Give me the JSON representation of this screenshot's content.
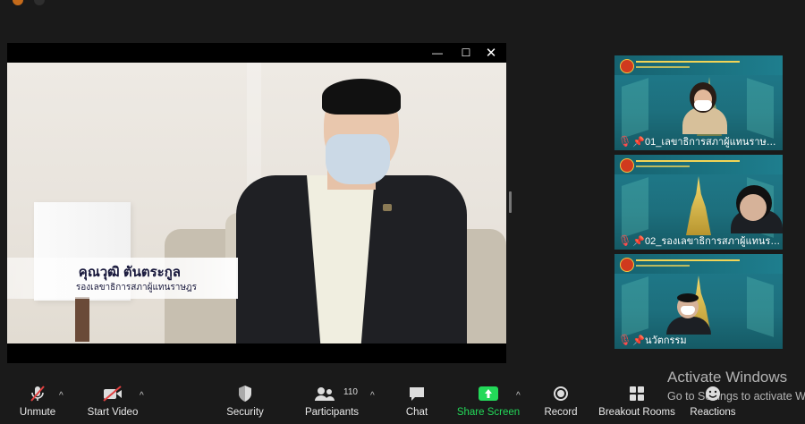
{
  "window_controls": {
    "minimize": "—",
    "maximize": "☐",
    "close": "✕"
  },
  "shared_video": {
    "caption_name": "คุณวุฒิ ตันตระกูล",
    "caption_role": "รองเลขาธิการสภาผู้แทนราษฎร"
  },
  "gallery": [
    {
      "name": "01_เลขาธิการสภาผู้แทนราษฎร ...",
      "muted": true,
      "pinned": true
    },
    {
      "name": "02_รองเลขาธิการสภาผู้แทนราษฎร ...",
      "muted": true,
      "pinned": true
    },
    {
      "name": "นวัตกรรม",
      "muted": true,
      "pinned": true
    }
  ],
  "toolbar": {
    "unmute": "Unmute",
    "start_video": "Start Video",
    "security": "Security",
    "participants": "Participants",
    "participants_count": "110",
    "chat": "Chat",
    "share_screen": "Share Screen",
    "record": "Record",
    "breakout_rooms": "Breakout Rooms",
    "reactions": "Reactions"
  },
  "watermark": {
    "title": "Activate Windows",
    "subtitle": "Go to Settings to activate Wi"
  },
  "colors": {
    "share_green": "#23d959",
    "muted_red": "#ff4d4d",
    "tile_teal": "#1f7b8c"
  }
}
